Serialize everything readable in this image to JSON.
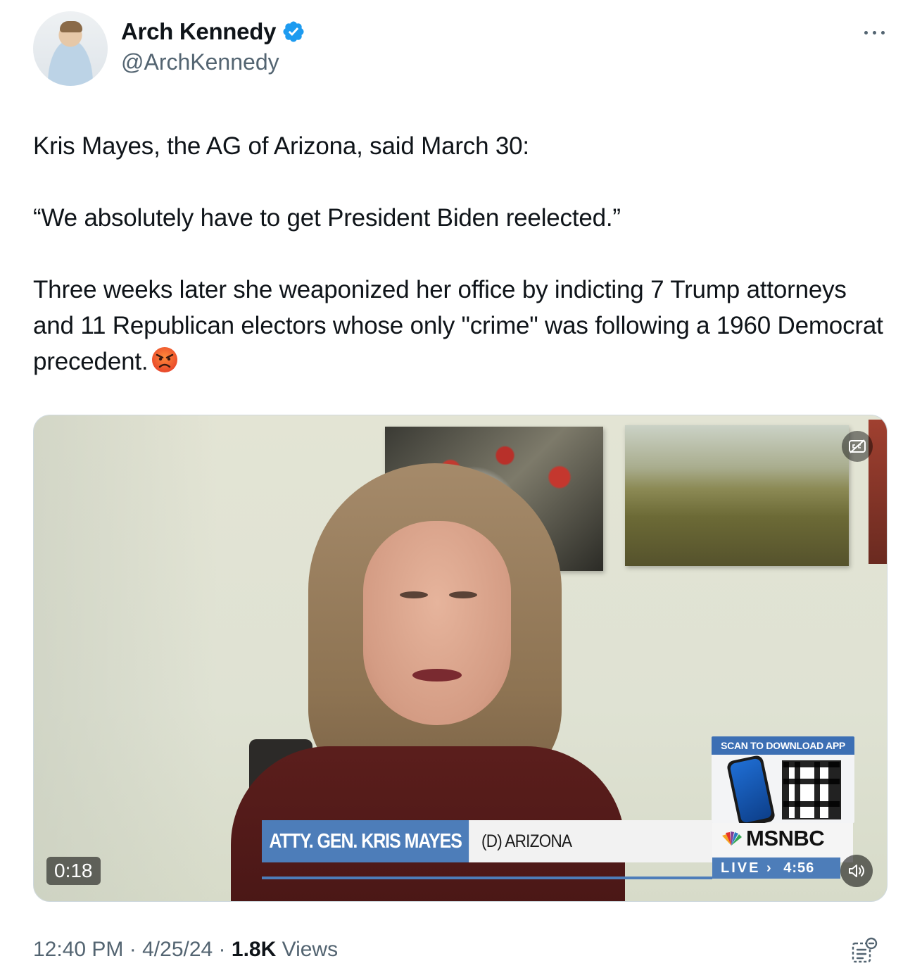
{
  "author": {
    "display_name": "Arch Kennedy",
    "handle": "@ArchKennedy",
    "verified": true,
    "verified_color": "#1d9bf0"
  },
  "tweet": {
    "paragraphs": [
      "Kris Mayes, the AG of Arizona, said March 30:",
      "“We absolutely have to get President Biden reelected.”",
      "Three weeks later she weaponized her office by indicting 7 Trump attorneys and 11 Republican electors whose only \"crime\" was following a 1960 Democrat precedent."
    ],
    "emoji": "angry-face"
  },
  "video": {
    "duration": "0:18",
    "captions_icon": "captions-off-icon",
    "volume_icon": "speaker-icon",
    "overlay": {
      "promo_title": "SCAN TO DOWNLOAD APP",
      "lower_third_name": "ATTY. GEN. KRIS MAYES",
      "lower_third_sub": "(D) ARIZONA",
      "network": "MSNBC",
      "live_label": "LIVE",
      "live_arrow": "›",
      "live_time": "4:56"
    }
  },
  "meta": {
    "time": "12:40 PM",
    "separator": "·",
    "date": "4/25/24",
    "views_count": "1.8K",
    "views_label": "Views"
  },
  "colors": {
    "text": "#0f1419",
    "secondary": "#536471",
    "accent": "#1d9bf0",
    "msnbc_blue": "#4d7db9"
  }
}
